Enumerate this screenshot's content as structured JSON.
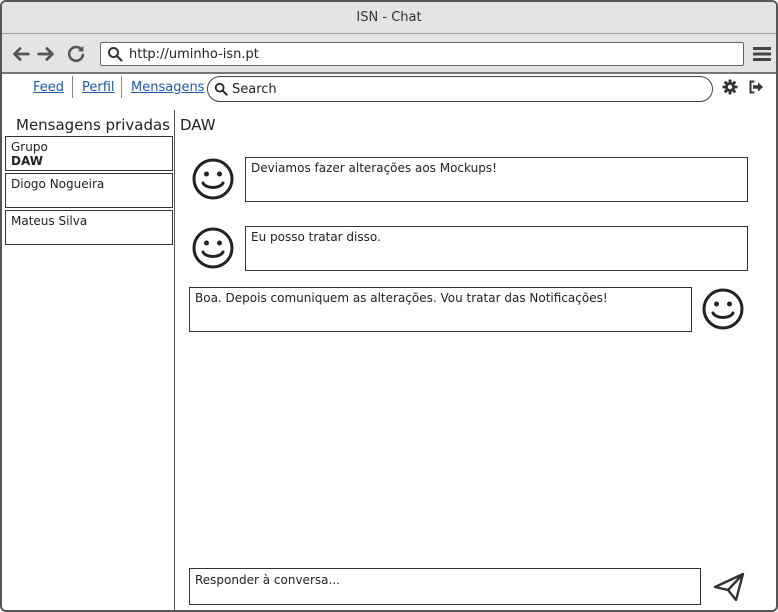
{
  "window": {
    "title": "ISN - Chat"
  },
  "browser": {
    "url": "http://uminho-isn.pt"
  },
  "nav": {
    "tabs": [
      {
        "label": "Feed"
      },
      {
        "label": "Perfil"
      },
      {
        "label": "Mensagens"
      }
    ]
  },
  "search": {
    "placeholder": "Search"
  },
  "sidebar": {
    "title": "Mensagens privadas",
    "conversations": [
      {
        "label": "Grupo",
        "sub": "DAW"
      },
      {
        "label": "Diogo Nogueira"
      },
      {
        "label": "Mateus Silva"
      }
    ]
  },
  "chat": {
    "title": "DAW",
    "messages": [
      {
        "text": "Deviamos fazer alterações aos Mockups!"
      },
      {
        "text": "Eu posso tratar disso."
      },
      {
        "text": "Boa. Depois comuniquem as alterações. Vou tratar das Notificações!"
      }
    ],
    "reply_placeholder": "Responder à conversa..."
  },
  "icons": {
    "back": "back-arrow-icon",
    "forward": "forward-arrow-icon",
    "reload": "reload-icon",
    "address": "search-icon",
    "menu": "hamburger-menu-icon",
    "settings": "gear-icon",
    "logout": "logout-icon",
    "avatar": "smiley-face-icon",
    "send": "send-icon"
  }
}
